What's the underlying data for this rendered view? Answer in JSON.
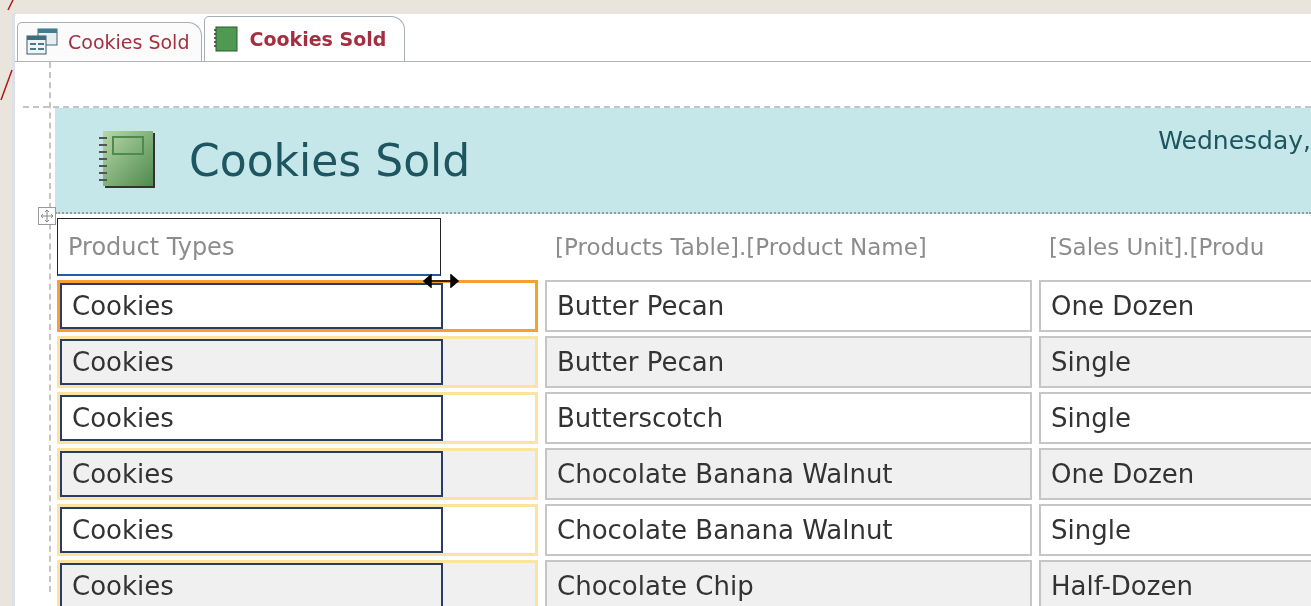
{
  "tabs": [
    {
      "label": "Cookies Sold",
      "selected": false,
      "kind": "table"
    },
    {
      "label": "Cookies Sold",
      "selected": true,
      "kind": "form"
    }
  ],
  "header": {
    "title": "Cookies Sold",
    "date": "Wednesday,"
  },
  "table": {
    "columns": [
      "Product Types",
      "[Products Table].[Product Name]",
      "[Sales Unit].[Produ"
    ],
    "rows": [
      {
        "cells": [
          "Cookies",
          "Butter Pecan",
          "One Dozen"
        ],
        "selected": true
      },
      {
        "cells": [
          "Cookies",
          "Butter Pecan",
          "Single"
        ],
        "selected": false
      },
      {
        "cells": [
          "Cookies",
          "Butterscotch",
          "Single"
        ],
        "selected": false
      },
      {
        "cells": [
          "Cookies",
          "Chocolate Banana Walnut",
          "One Dozen"
        ],
        "selected": false
      },
      {
        "cells": [
          "Cookies",
          "Chocolate Banana Walnut",
          "Single"
        ],
        "selected": false
      },
      {
        "cells": [
          "Cookies",
          "Chocolate Chip",
          "Half-Dozen"
        ],
        "selected": false
      }
    ]
  }
}
